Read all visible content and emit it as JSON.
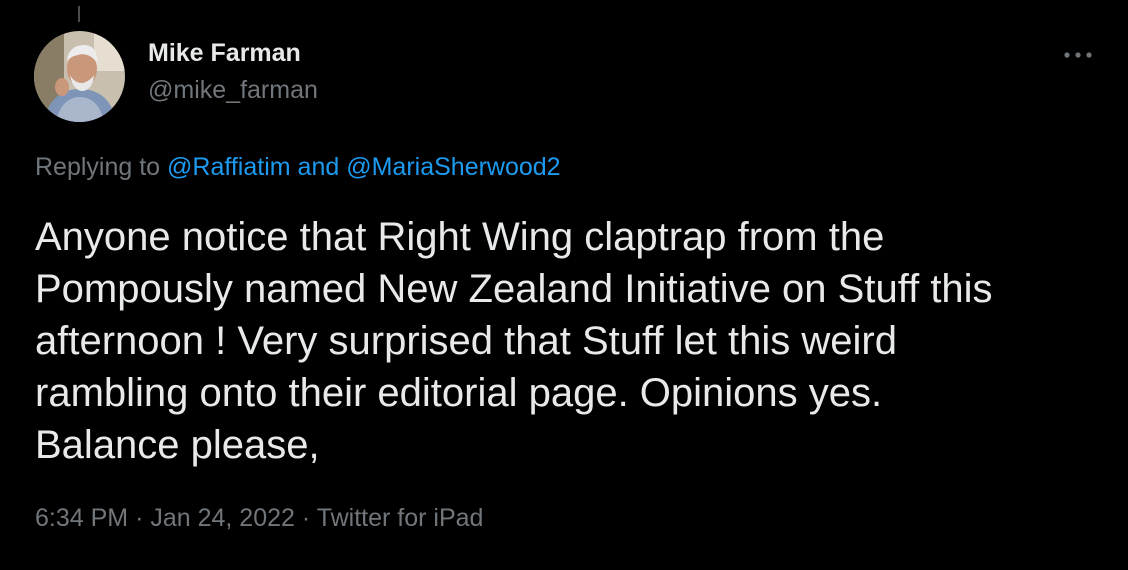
{
  "author": {
    "display_name": "Mike Farman",
    "handle": "@mike_farman",
    "avatar_icon": "profile-photo"
  },
  "reply": {
    "prefix": "Replying to",
    "mention1": "@Raffiatim",
    "conjunction": "and",
    "mention2": "@MariaSherwood2"
  },
  "tweet": {
    "text": "Anyone notice that Right Wing claptrap from the\nPompously named New Zealand Initiative on Stuff this\nafternoon ! Very surprised that Stuff let this weird\nrambling onto their editorial page. Opinions yes.\nBalance please,"
  },
  "meta": {
    "time": "6:34 PM",
    "separator": "·",
    "date": "Jan 24, 2022",
    "source": "Twitter for iPad"
  },
  "menu": {
    "icon": "more-horizontal-icon"
  },
  "colors": {
    "background": "#000000",
    "primary_text": "#e7e9ea",
    "secondary_text": "#71767b",
    "link": "#1d9bf0"
  }
}
